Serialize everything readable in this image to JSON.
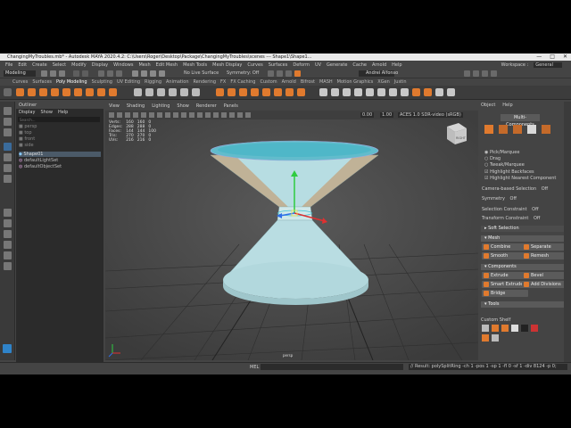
{
  "window": {
    "title": "ChangingMyTroubles.mb* - Autodesk MAYA 2020.4.2: C:\\Users\\Roger\\Desktop\\Package\\ChangingMyTroubles\\scenes   ---   Shape1\\Shape1...",
    "controls": [
      "—",
      "□",
      "✕"
    ]
  },
  "menubar": {
    "items": [
      "File",
      "Edit",
      "Create",
      "Select",
      "Modify",
      "Display",
      "Windows",
      "Mesh",
      "Edit Mesh",
      "Mesh Tools",
      "Mesh Display",
      "Curves",
      "Surfaces",
      "Deform",
      "UV",
      "Generate",
      "Cache",
      "Arnold",
      "Help"
    ],
    "workspace_label": "Workspace :",
    "workspace_value": "General"
  },
  "statusline": {
    "mode": "Modeling",
    "live_surface": "No Live Surface",
    "symmetry": "Symmetry: Off",
    "user": "Andrei Alfonso"
  },
  "shelf": {
    "tabs": [
      "Curves",
      "Surfaces",
      "Poly Modeling",
      "Sculpting",
      "UV Editing",
      "Rigging",
      "Animation",
      "Rendering",
      "FX",
      "FX Caching",
      "Custom",
      "Arnold",
      "Bifrost",
      "MASH",
      "Motion Graphics",
      "XGen",
      "Justin"
    ]
  },
  "outliner": {
    "title": "Outliner",
    "menu": [
      "Display",
      "Show",
      "Help"
    ],
    "search_placeholder": "Search...",
    "items": [
      "persp",
      "top",
      "front",
      "side",
      "Shape01",
      "defaultLightSet",
      "defaultObjectSet"
    ]
  },
  "viewport": {
    "menu": [
      "View",
      "Shading",
      "Lighting",
      "Show",
      "Renderer",
      "Panels"
    ],
    "hud_headers": [
      "",
      "",
      "",
      ""
    ],
    "hud_rows": [
      [
        "Verts:",
        "160",
        "160",
        "0"
      ],
      [
        "Edges:",
        "288",
        "288",
        "0"
      ],
      [
        "Faces:",
        "144",
        "144",
        "100"
      ],
      [
        "Tris:",
        "270",
        "270",
        "0"
      ],
      [
        "UVs:",
        "216",
        "216",
        "0"
      ]
    ],
    "camera_label": "persp",
    "viewcube_label": "RIGHT",
    "exposure": "0.00",
    "gamma": "1.00",
    "colorspace": "ACES 1.0 SDR-video (sRGB)"
  },
  "attribute_panel": {
    "tabs": [
      "Object",
      "Help"
    ],
    "header": "Multi-Components",
    "pick_modes": [
      "Pick/Marquee",
      "Drag",
      "Tweak/Marquee"
    ],
    "checkboxes": [
      "Highlight Backfaces",
      "Highlight Nearest Component"
    ],
    "props": [
      {
        "label": "Camera-based Selection",
        "value": "Off"
      },
      {
        "label": "Symmetry",
        "value": "Off"
      },
      {
        "label": "Selection Constraint",
        "value": "Off"
      },
      {
        "label": "Transform Constraint",
        "value": "Off"
      }
    ],
    "soft_selection": "Soft Selection",
    "sections": {
      "mesh": "Mesh",
      "components": "Components",
      "tools": "Tools"
    },
    "mesh_buttons": [
      "Combine",
      "Separate",
      "Smooth",
      "Remesh"
    ],
    "component_buttons": [
      "Extrude",
      "Bevel",
      "Smart Extrude",
      "Add Divisions",
      "Bridge"
    ],
    "custom_shelf": "Custom Shelf"
  },
  "commandline": {
    "lang": "MEL",
    "output": "// Result: polySplitRing -ch 1 -pos 1 -sp 1 -fl 0 -sf 1 -div 8124 -p 0;"
  },
  "colors": {
    "accent": "#e07a2e",
    "mesh": "#b7dde2",
    "top_cap": "#62bccc",
    "highlight": "#43c2d3"
  }
}
